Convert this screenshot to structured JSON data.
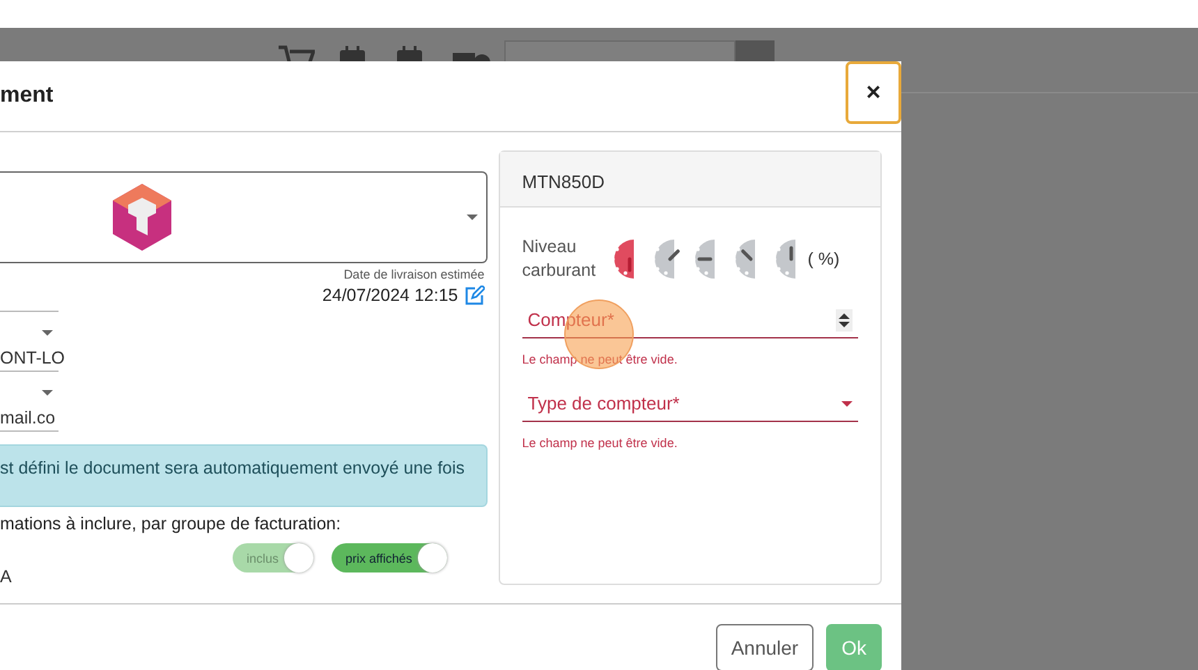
{
  "dialog": {
    "title": "ment",
    "close": "×",
    "delivery": {
      "label": "Date de livraison estimée",
      "value": "24/07/2024 12:15"
    },
    "fields": [
      {
        "kind": "text"
      },
      {
        "kind": "select",
        "value": "ONT-LO"
      },
      {
        "kind": "select",
        "value": "mail.co"
      }
    ],
    "alert": "st défini le document sera automatiquement envoyé une fois",
    "include_label": "mations à inclure, par groupe de facturation:",
    "toggles": [
      {
        "label": "inclus",
        "on": true,
        "disabled": true
      },
      {
        "label": "prix affichés",
        "on": true,
        "disabled": false
      }
    ],
    "group": "A",
    "panel": {
      "title": "MTN850D",
      "fuel_label": "Niveau carburant",
      "fuel_unit": "( %)",
      "gauges": [
        {
          "selected": true
        },
        {
          "selected": false
        },
        {
          "selected": false
        },
        {
          "selected": false
        },
        {
          "selected": false
        }
      ],
      "inputs": [
        {
          "kind": "number",
          "label": "Compteur*",
          "error": "Le champ ne peut être vide."
        },
        {
          "kind": "select",
          "label": "Type de compteur*",
          "error": "Le champ ne peut être vide."
        }
      ]
    },
    "buttons": [
      {
        "kind": "secondary",
        "label": "Annuler"
      },
      {
        "kind": "primary",
        "label": "Ok"
      }
    ]
  }
}
